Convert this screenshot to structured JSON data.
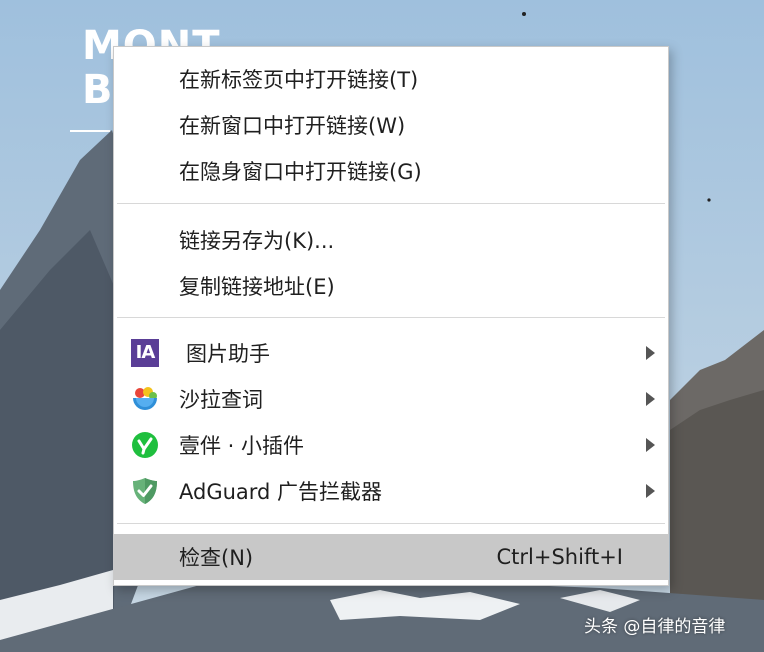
{
  "background": {
    "logo_line1": "MONT",
    "logo_line2": "BL",
    "watermark": "头条 @自律的音律"
  },
  "menu": {
    "items": [
      {
        "label": "在新标签页中打开链接(T)"
      },
      {
        "label": "在新窗口中打开链接(W)"
      },
      {
        "label": "在隐身窗口中打开链接(G)"
      },
      {
        "label": "链接另存为(K)..."
      },
      {
        "label": "复制链接地址(E)"
      },
      {
        "label": "图片助手",
        "icon": "image-assistant-icon",
        "icon_text": "IA"
      },
      {
        "label": "沙拉查词",
        "icon": "saladict-icon"
      },
      {
        "label": "壹伴 · 小插件",
        "icon": "yiban-icon"
      },
      {
        "label": "AdGuard 广告拦截器",
        "icon": "adguard-shield-icon"
      },
      {
        "label": "检查(N)",
        "shortcut": "Ctrl+Shift+I"
      }
    ]
  },
  "colors": {
    "highlight": "#c8c8c8",
    "image_assistant": "#5a3e96",
    "yiban_green": "#1fbf3e",
    "adguard_green": "#67b279"
  }
}
